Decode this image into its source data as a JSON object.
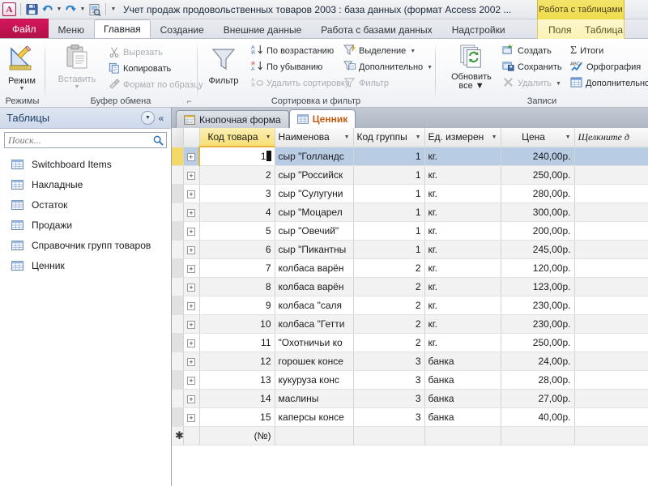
{
  "window": {
    "title": "Учет продаж продовольственных товаров 2003 : база данных (формат Access 2002 ...",
    "contextual_tab_title": "Работа с таблицами",
    "app_logo": "access-logo"
  },
  "quick_access": {
    "items": [
      {
        "name": "save-icon",
        "label": "Сохранить"
      },
      {
        "name": "undo-icon",
        "label": "Отменить"
      },
      {
        "name": "redo-icon",
        "label": "Вернуть"
      },
      {
        "name": "print-preview-icon",
        "label": "Предварительный просмотр"
      },
      {
        "name": "customize-qat-icon",
        "label": "Настройка панели быстрого доступа"
      }
    ]
  },
  "ribbon": {
    "tabs": [
      {
        "label": "Файл",
        "active": false,
        "kind": "file"
      },
      {
        "label": "Меню",
        "active": false,
        "kind": "normal"
      },
      {
        "label": "Главная",
        "active": true,
        "kind": "normal"
      },
      {
        "label": "Создание",
        "active": false,
        "kind": "normal"
      },
      {
        "label": "Внешние данные",
        "active": false,
        "kind": "normal"
      },
      {
        "label": "Работа с базами данных",
        "active": false,
        "kind": "normal"
      },
      {
        "label": "Надстройки",
        "active": false,
        "kind": "normal"
      },
      {
        "label": "Поля",
        "active": false,
        "kind": "contextual"
      },
      {
        "label": "Таблица",
        "active": false,
        "kind": "contextual"
      }
    ],
    "groups": {
      "views": {
        "label": "Режимы",
        "button": "Режим"
      },
      "clipboard": {
        "label": "Буфер обмена",
        "paste": "Вставить",
        "cut": "Вырезать",
        "copy": "Копировать",
        "format_painter": "Формат по образцу"
      },
      "sort_filter": {
        "label": "Сортировка и фильтр",
        "filter": "Фильтр",
        "asc": "По возрастанию",
        "desc": "По убыванию",
        "clear_sort": "Удалить сортировку",
        "selection": "Выделение",
        "advanced": "Дополнительно",
        "toggle_filter": "Фильтр"
      },
      "records": {
        "label": "Записи",
        "refresh_all": "Обновить\nвсе",
        "refresh_all_line1": "Обновить",
        "refresh_all_line2": "все",
        "new": "Создать",
        "save": "Сохранить",
        "delete": "Удалить",
        "totals": "Итоги",
        "spelling": "Орфография",
        "more": "Дополнительно"
      }
    }
  },
  "navigation_pane": {
    "title": "Таблицы",
    "search_placeholder": "Поиск...",
    "search_value": "",
    "items": [
      {
        "label": "Switchboard Items"
      },
      {
        "label": "Накладные"
      },
      {
        "label": "Остаток"
      },
      {
        "label": "Продажи"
      },
      {
        "label": "Справочник групп товаров"
      },
      {
        "label": "Ценник"
      }
    ]
  },
  "document_tabs": [
    {
      "label": "Кнопочная форма",
      "active": false,
      "icon": "form-icon"
    },
    {
      "label": "Ценник",
      "active": true,
      "icon": "table-icon"
    }
  ],
  "datasheet": {
    "columns": [
      {
        "label": "Код товара",
        "selected": true,
        "align": "right"
      },
      {
        "label": "Наименова",
        "selected": false,
        "align": "left"
      },
      {
        "label": "Код группы",
        "selected": false,
        "align": "right"
      },
      {
        "label": "Ед. измерен",
        "selected": false,
        "align": "left"
      },
      {
        "label": "Цена",
        "selected": false,
        "align": "right"
      },
      {
        "label": "Щелкните д",
        "selected": false,
        "align": "left"
      }
    ],
    "rows": [
      {
        "code": "1",
        "name": "сыр \"Голландс",
        "group": "1",
        "unit": "кг.",
        "price": "240,00р."
      },
      {
        "code": "2",
        "name": "сыр \"Российск",
        "group": "1",
        "unit": "кг.",
        "price": "250,00р."
      },
      {
        "code": "3",
        "name": "сыр \"Сулугуни",
        "group": "1",
        "unit": "кг.",
        "price": "280,00р."
      },
      {
        "code": "4",
        "name": "сыр \"Моцарел",
        "group": "1",
        "unit": "кг.",
        "price": "300,00р."
      },
      {
        "code": "5",
        "name": "сыр \"Овечий\"",
        "group": "1",
        "unit": "кг.",
        "price": "200,00р."
      },
      {
        "code": "6",
        "name": "сыр \"Пикантны",
        "group": "1",
        "unit": "кг.",
        "price": "245,00р."
      },
      {
        "code": "7",
        "name": "колбаса варён",
        "group": "2",
        "unit": "кг.",
        "price": "120,00р."
      },
      {
        "code": "8",
        "name": "колбаса варён",
        "group": "2",
        "unit": "кг.",
        "price": "123,00р."
      },
      {
        "code": "9",
        "name": "колбаса \"саля",
        "group": "2",
        "unit": "кг.",
        "price": "230,00р."
      },
      {
        "code": "10",
        "name": "колбаса \"Гетти",
        "group": "2",
        "unit": "кг.",
        "price": "230,00р."
      },
      {
        "code": "11",
        "name": "\"Охотничьи ко",
        "group": "2",
        "unit": "кг.",
        "price": "250,00р."
      },
      {
        "code": "12",
        "name": "горошек консе",
        "group": "3",
        "unit": "банка",
        "price": "24,00р."
      },
      {
        "code": "13",
        "name": "кукуруза конс",
        "group": "3",
        "unit": "банка",
        "price": "28,00р."
      },
      {
        "code": "14",
        "name": "маслины",
        "group": "3",
        "unit": "банка",
        "price": "27,00р."
      },
      {
        "code": "15",
        "name": "каперсы консе",
        "group": "3",
        "unit": "банка",
        "price": "40,00р."
      }
    ],
    "new_record": {
      "code": "(№)"
    },
    "selected_row_index": 0,
    "editing_cell_value": "1"
  },
  "colors": {
    "file_tab": "#d6165c",
    "contextual_tab": "#efdc4c",
    "selected_column_header": "#f6df73",
    "selected_row": "#b8cce4",
    "current_record_marker": "#f4d86a",
    "active_doc_tab_text": "#c55a11",
    "nav_header": "#cdd8ea"
  }
}
